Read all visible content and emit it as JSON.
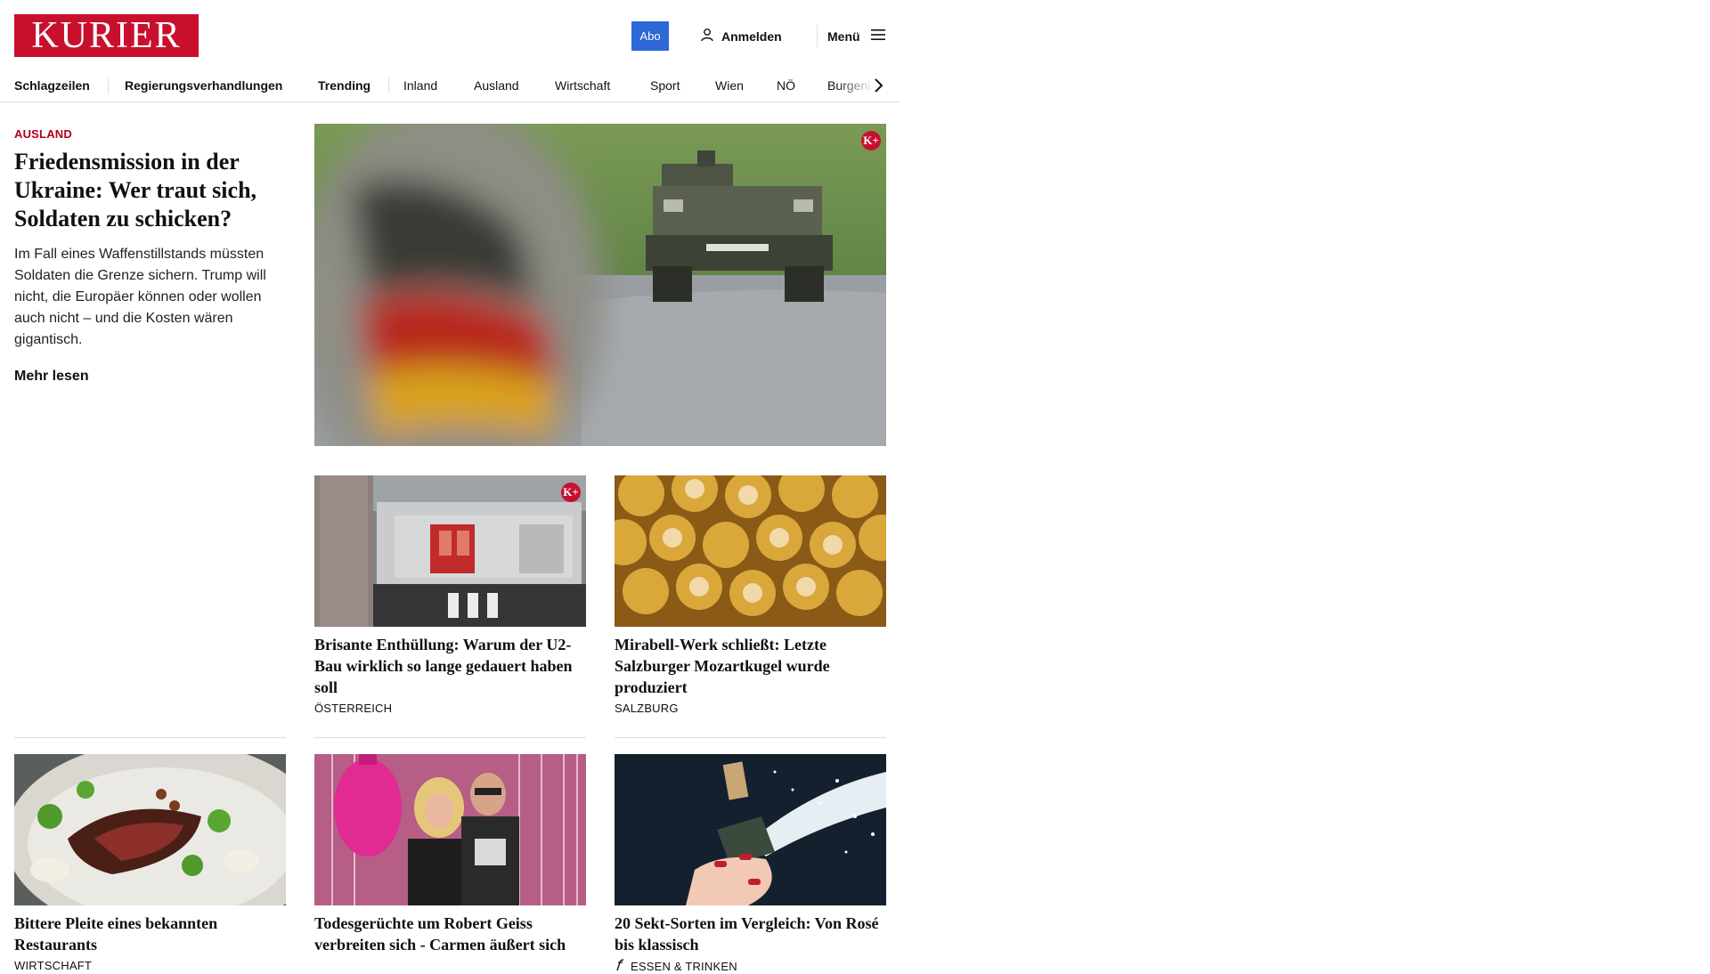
{
  "header": {
    "logo": "KURIER",
    "abo": "Abo",
    "login": "Anmelden",
    "menu": "Menü",
    "colors": {
      "brand": "#c8102e",
      "abo": "#2e67d6"
    }
  },
  "nav": {
    "items": [
      "Schlagzeilen",
      "Regierungsverhandlungen",
      "Trending",
      "Inland",
      "Ausland",
      "Wirtschaft",
      "Sport",
      "Wien",
      "NÖ",
      "Burgenland"
    ]
  },
  "lead": {
    "kicker": "AUSLAND",
    "title": "Friedensmission in der Ukraine: Wer traut sich, Soldaten zu schicken?",
    "teaser": "Im Fall eines Waffenstillstands müssten Soldaten die Grenze sichern. Trump will nicht, die Europäer können oder wollen auch nicht – und die Kosten wären gigantisch.",
    "more": "Mehr lesen",
    "badge": "K+"
  },
  "cards": [
    {
      "title": "Brisante Enthüllung: Warum der U2-Bau wirklich so lange gedauert haben soll",
      "category": "ÖSTERREICH",
      "badge": "K+"
    },
    {
      "title": "Mirabell-Werk schließt: Letzte Salzburger Mozartkugel wurde produziert",
      "category": "SALZBURG"
    },
    {
      "title": "Bittere Pleite eines bekannten Restaurants",
      "category": "WIRTSCHAFT"
    },
    {
      "title": "Todesgerüchte um Robert Geiss verbreiten sich - Carmen äußert sich",
      "category": ""
    },
    {
      "title": "20 Sekt-Sorten im Vergleich: Von Rosé bis klassisch",
      "category": "ESSEN & TRINKEN",
      "icon": "fork-icon"
    }
  ]
}
